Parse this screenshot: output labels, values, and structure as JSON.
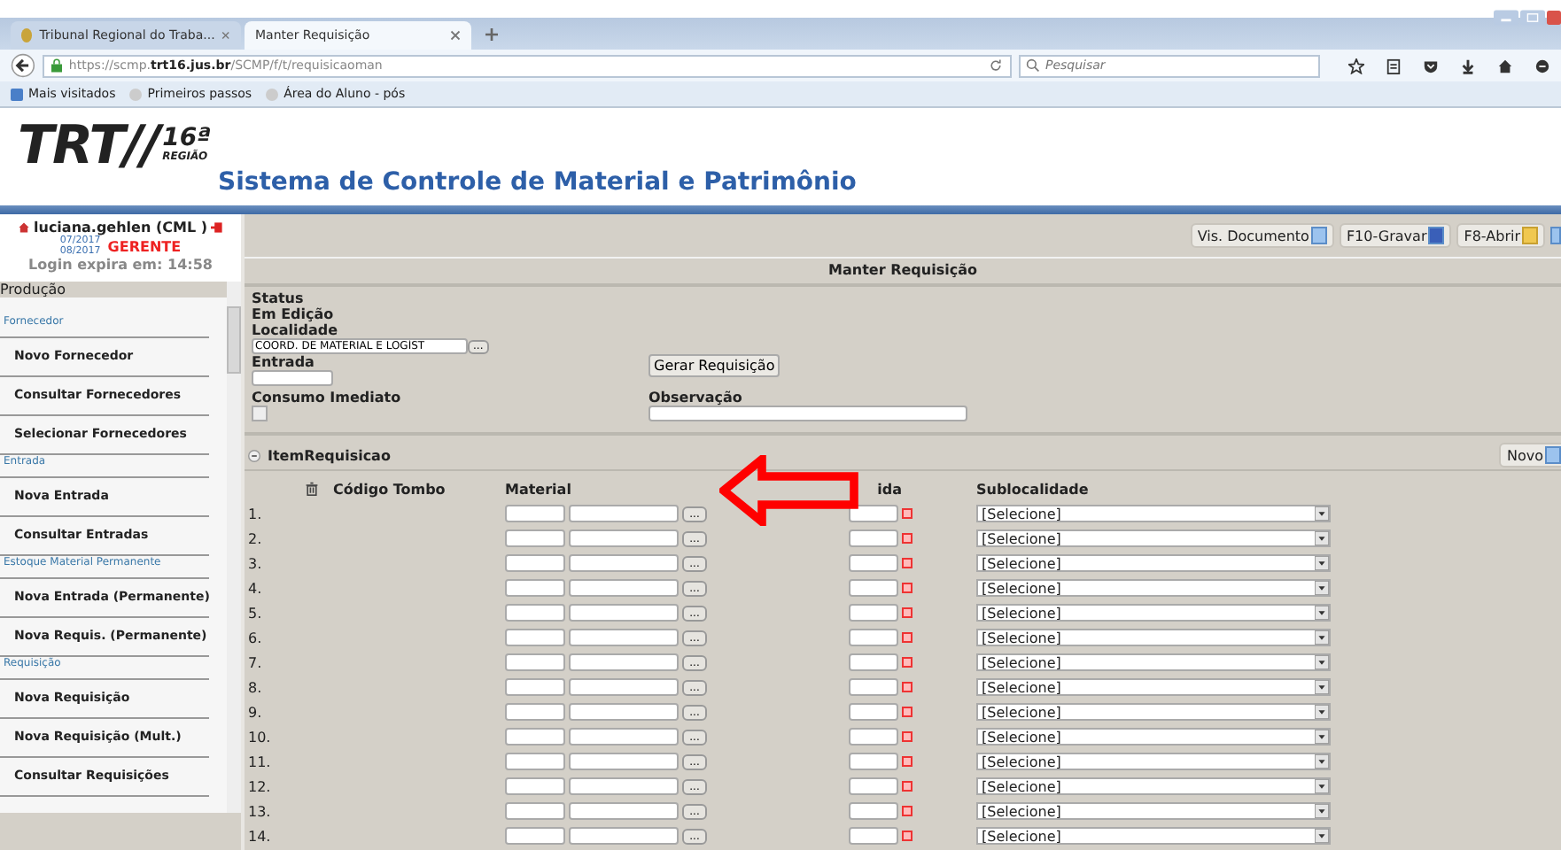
{
  "browser": {
    "tabs": [
      {
        "title": "Tribunal Regional do Traba...",
        "selected": false
      },
      {
        "title": "Manter Requisição",
        "selected": true
      }
    ],
    "url": {
      "prefix": "https://scmp.",
      "domain": "trt16.jus.br",
      "suffix": "/SCMP/f/t/requisicaoman"
    },
    "search": {
      "placeholder": "Pesquisar"
    },
    "bookmarks": [
      "Mais visitados",
      "Primeiros passos",
      "Área do Aluno - pós"
    ]
  },
  "header": {
    "logo": "TRT//",
    "region_number": "16ª",
    "region": "REGIÃO",
    "title": "Sistema de Controle de Material e Patrimônio"
  },
  "user": {
    "name": "luciana.gehlen  (CML  )",
    "periods": [
      "07/2017",
      "08/2017"
    ],
    "role": "GERENTE",
    "session": "Login expira em: 14:58"
  },
  "sidebar": {
    "title": "Produção",
    "items": [
      {
        "kind": "section",
        "label": "Fornecedor"
      },
      {
        "kind": "item",
        "label": "Novo Fornecedor"
      },
      {
        "kind": "item",
        "label": "Consultar Fornecedores"
      },
      {
        "kind": "item",
        "label": "Selecionar Fornecedores"
      },
      {
        "kind": "section",
        "label": "Entrada"
      },
      {
        "kind": "item",
        "label": "Nova Entrada"
      },
      {
        "kind": "item",
        "label": "Consultar Entradas"
      },
      {
        "kind": "section",
        "label": "Estoque Material Permanente"
      },
      {
        "kind": "item",
        "label": "Nova Entrada (Permanente)"
      },
      {
        "kind": "item",
        "label": "Nova Requis. (Permanente)"
      },
      {
        "kind": "section",
        "label": "Requisição"
      },
      {
        "kind": "item",
        "label": "Nova Requisição"
      },
      {
        "kind": "item",
        "label": "Nova Requisição (Mult.)"
      },
      {
        "kind": "item",
        "label": "Consultar Requisições"
      }
    ]
  },
  "toolbar": [
    "Vis. Documento",
    "F10-Gravar",
    "F8-Abrir"
  ],
  "page_title": "Manter Requisição",
  "form": {
    "status_label": "Status",
    "status": "Em Edição",
    "localidade_label": "Localidade",
    "localidade": "COORD. DE MATERIAL E LOGÍST",
    "browse": "...",
    "entrada_label": "Entrada",
    "consumo_label": "Consumo Imediato",
    "consumo_checked": false,
    "generate_button": "Gerar Requisição",
    "observacao_label": "Observação"
  },
  "items": {
    "title": "ItemRequisicao",
    "new_button": "Novo",
    "columns": [
      "Código Tombo",
      "Material",
      "ida",
      "Sublocalidade"
    ],
    "rows": [
      {
        "number": "1.",
        "sublocalidade": "[Selecione]"
      },
      {
        "number": "2.",
        "sublocalidade": "[Selecione]"
      },
      {
        "number": "3.",
        "sublocalidade": "[Selecione]"
      },
      {
        "number": "4.",
        "sublocalidade": "[Selecione]"
      },
      {
        "number": "5.",
        "sublocalidade": "[Selecione]"
      },
      {
        "number": "6.",
        "sublocalidade": "[Selecione]"
      },
      {
        "number": "7.",
        "sublocalidade": "[Selecione]"
      },
      {
        "number": "8.",
        "sublocalidade": "[Selecione]"
      },
      {
        "number": "9.",
        "sublocalidade": "[Selecione]"
      },
      {
        "number": "10.",
        "sublocalidade": "[Selecione]"
      },
      {
        "number": "11.",
        "sublocalidade": "[Selecione]"
      },
      {
        "number": "12.",
        "sublocalidade": "[Selecione]"
      },
      {
        "number": "13.",
        "sublocalidade": "[Selecione]"
      },
      {
        "number": "14.",
        "sublocalidade": "[Selecione]"
      }
    ],
    "browse": "..."
  }
}
